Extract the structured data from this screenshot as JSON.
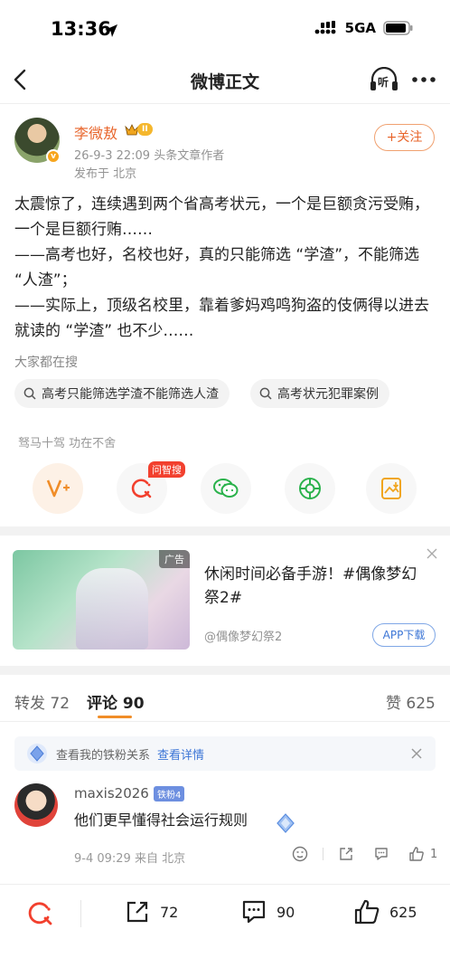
{
  "status_bar": {
    "time": "13:36",
    "network": "5GA"
  },
  "nav": {
    "title": "微博正文",
    "listen_label": "听"
  },
  "author": {
    "name": "李微敖",
    "level": "II",
    "date_role": "26-9-3 22:09  头条文章作者",
    "location": "发布于 北京",
    "follow_label": "+关注"
  },
  "post": {
    "body": "太震惊了，连续遇到两个省高考状元，一个是巨额贪污受贿，一个是巨额行贿……\n——高考也好，名校也好，真的只能筛选 “学渣”，不能筛选 “人渣”；\n——实际上，顶级名校里，靠着爹妈鸡鸣狗盗的伎俩得以进去就读的 “学渣” 也不少……"
  },
  "search": {
    "title": "大家都在搜",
    "chips": [
      "高考只能筛选学渣不能筛选人渣",
      "高考状元犯罪案例"
    ]
  },
  "share": {
    "slogan": "驽马十驾 功在不舍",
    "tag": "问智搜",
    "icons": [
      "v-plus-icon",
      "wenzhisou-icon",
      "wechat-icon",
      "moments-icon",
      "save-image-icon"
    ]
  },
  "ad": {
    "tag": "广告",
    "title": "休闲时间必备手游！#偶像梦幻祭2#",
    "author": "@偶像梦幻祭2",
    "button": "APP下载"
  },
  "tabs": {
    "repost": "转发 72",
    "comments": "评论 90",
    "likes": "赞 625"
  },
  "fans": {
    "text": "查看我的铁粉关系",
    "link": "查看详情"
  },
  "comment": {
    "user": "maxis2026",
    "badge": "铁粉4",
    "text": "他们更早懂得社会运行规则",
    "meta": "9-4 09:29  来自 北京",
    "likes": "1"
  },
  "bottom": {
    "repost": "72",
    "comments": "90",
    "likes": "625"
  },
  "colors": {
    "accent": "#e8652b",
    "link": "#3b75d6",
    "tab_underline": "#f08d28"
  }
}
